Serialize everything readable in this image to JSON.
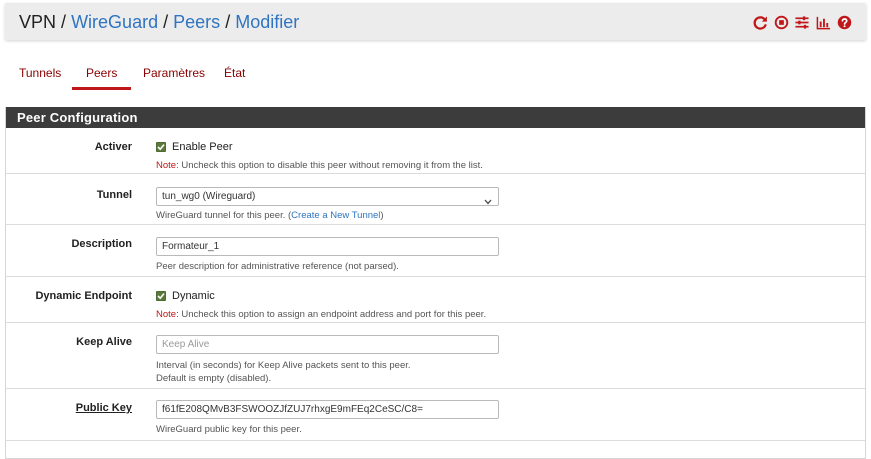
{
  "breadcrumb": {
    "root": "VPN",
    "sep": "/",
    "items": [
      "WireGuard",
      "Peers",
      "Modifier"
    ]
  },
  "toolbar": {
    "icons": [
      "reload-icon",
      "stop-circle-icon",
      "sliders-icon",
      "bar-chart-icon",
      "help-icon"
    ],
    "color": "#c0181a"
  },
  "tabs": [
    {
      "label": "Tunnels",
      "active": false
    },
    {
      "label": "Peers",
      "active": true
    },
    {
      "label": "Paramètres",
      "active": false
    },
    {
      "label": "État",
      "active": false
    }
  ],
  "panel": {
    "title": "Peer Configuration",
    "rows": {
      "activer": {
        "label": "Activer",
        "checkbox_label": "Enable Peer",
        "checked": true,
        "note_prefix": "Note:",
        "note_text": " Uncheck this option to disable this peer without removing it from the list."
      },
      "tunnel": {
        "label": "Tunnel",
        "selected": "tun_wg0 (Wireguard)",
        "help_text": "WireGuard tunnel for this peer. (",
        "help_link": "Create a New Tunnel",
        "help_end": ")"
      },
      "description": {
        "label": "Description",
        "value": "Formateur_1",
        "help": "Peer description for administrative reference (not parsed)."
      },
      "dynamic_endpoint": {
        "label": "Dynamic Endpoint",
        "checkbox_label": "Dynamic",
        "checked": true,
        "note_prefix": "Note:",
        "note_text": " Uncheck this option to assign an endpoint address and port for this peer."
      },
      "keep_alive": {
        "label": "Keep Alive",
        "placeholder": "Keep Alive",
        "value": "",
        "help_line1": "Interval (in seconds) for Keep Alive packets sent to this peer.",
        "help_line2": "Default is empty (disabled)."
      },
      "public_key": {
        "label": "Public Key",
        "value": "f61fE208QMvB3FSWOOZJfZUJ7rhxgE9mFEq2CeSC/C8=",
        "help": "WireGuard public key for this peer."
      }
    }
  },
  "colors": {
    "accent": "#c0181a",
    "link": "#2f74c0",
    "heading_bg": "#3c3c3c",
    "breadcrumb_bg": "#ececec"
  }
}
